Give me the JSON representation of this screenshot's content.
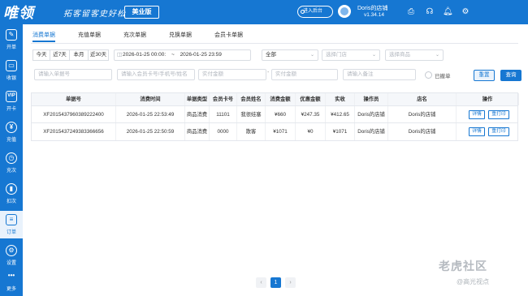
{
  "header": {
    "logo": "唯领",
    "slogan": "拓客留客史好松",
    "edition": "美业版",
    "enter_backend": "进入后台",
    "store_name": "Doris的店铺",
    "version": "v1.34.14",
    "icons": [
      "print-icon",
      "headset-icon",
      "bell-icon",
      "gear-icon"
    ]
  },
  "sidebar": {
    "items": [
      {
        "label": "开单",
        "icon": "edit-icon",
        "glyph": "✎"
      },
      {
        "label": "收银",
        "icon": "cashier-icon",
        "glyph": "▭"
      },
      {
        "label": "开卡",
        "icon": "vip-card-icon",
        "glyph": "VIP"
      },
      {
        "label": "充值",
        "icon": "yen-icon",
        "glyph": "¥"
      },
      {
        "label": "充次",
        "icon": "clock-icon",
        "glyph": "◷"
      },
      {
        "label": "扣次",
        "icon": "chart-icon",
        "glyph": "▮"
      },
      {
        "label": "订单",
        "icon": "order-icon",
        "glyph": "≡"
      },
      {
        "label": "设置",
        "icon": "gear-icon",
        "glyph": "⚙"
      },
      {
        "label": "更多",
        "icon": "more-icon",
        "glyph": "•••"
      }
    ],
    "active_index": 6
  },
  "tabs": [
    "消费单据",
    "充值单据",
    "充次单据",
    "兑换单据",
    "会员卡单据"
  ],
  "active_tab": 0,
  "filters": {
    "quick_dates": [
      "今天",
      "近7天",
      "本月",
      "近30天"
    ],
    "date_start": "2026-01-25 00:00:",
    "date_sep": "~",
    "date_end": "2026-01-25 23:59",
    "type_select": "全部",
    "store_select": "选择门店",
    "product_select": "选择商品",
    "order_no_ph": "请输入单据号",
    "member_ph": "请输入会员卡号/手机号/姓名",
    "amount_min_ph": "实付金额",
    "amount_sep": "-",
    "amount_max_ph": "实付金额",
    "remark_ph": "请输入备注",
    "withdrawn_label": "已撤单",
    "reset": "重置",
    "query": "查询"
  },
  "table": {
    "columns": [
      "单据号",
      "消费时间",
      "单据类型",
      "会员卡号",
      "会员姓名",
      "消费金额",
      "优惠金额",
      "实收",
      "操作员",
      "店名",
      "操作"
    ],
    "rows": [
      [
        "XF2015437960389222400",
        "2026-01-25 22:53:49",
        "商品消费",
        "11101",
        "我很娃塞",
        "¥660",
        "¥247.35",
        "¥412.65",
        "Doris的店铺",
        "Doris的店铺"
      ],
      [
        "XF2015437249383366656",
        "2026-01-25 22:50:59",
        "商品消费",
        "0000",
        "散客",
        "¥1071",
        "¥0",
        "¥1071",
        "Doris的店铺",
        "Doris的店铺"
      ]
    ],
    "action_detail": "详情",
    "action_reprint": "重打印"
  },
  "pagination": {
    "prev": "‹",
    "current": "1",
    "next": "›"
  },
  "watermark": {
    "line1": "老虎社区",
    "line2": "@高光视点"
  },
  "colors": {
    "primary": "#1677d2"
  }
}
